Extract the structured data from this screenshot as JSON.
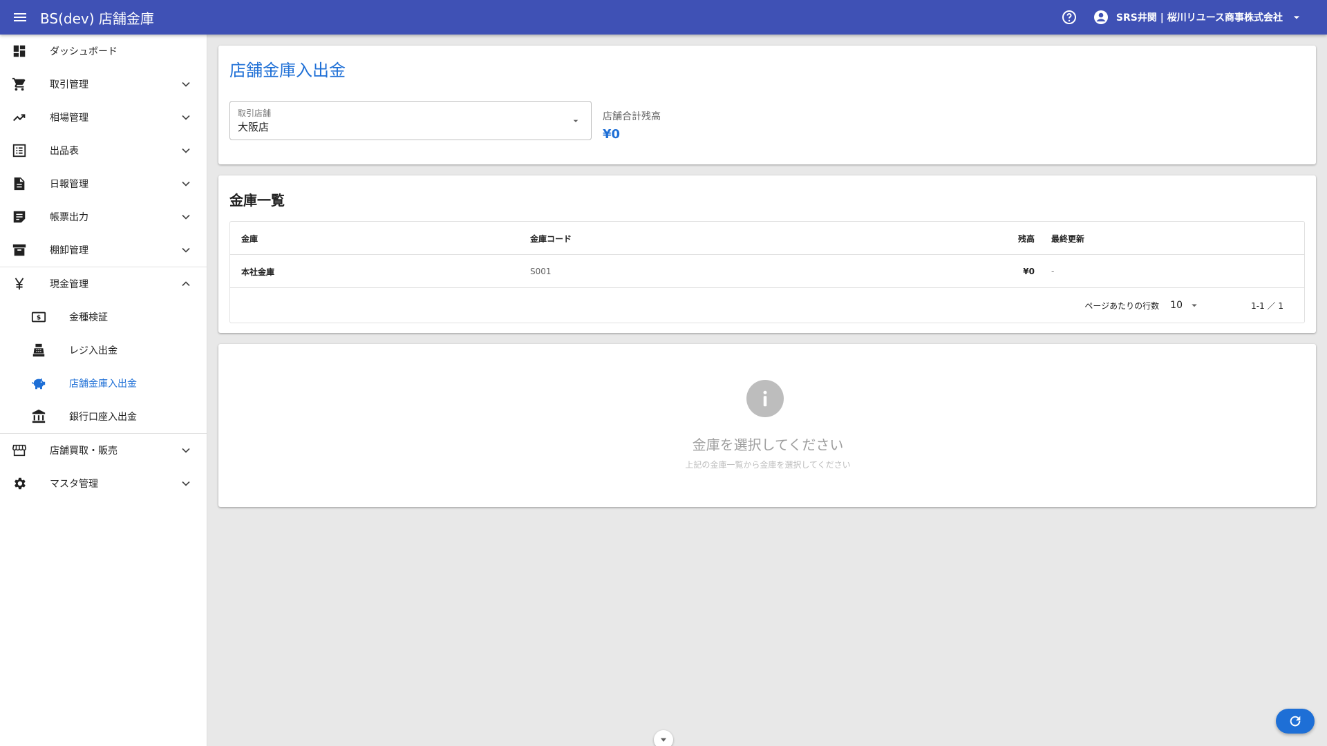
{
  "appbar": {
    "title": "BS(dev) 店舗金庫",
    "account_name": "SRS井関 | 桜川リユース商事株式会社",
    "color": "#3f51b5",
    "icons": [
      "menu-icon",
      "help-icon",
      "account-circle-icon",
      "arrow-drop-down-icon"
    ]
  },
  "sidebar": {
    "items": [
      {
        "label": "ダッシュボード",
        "icon": "dashboard-icon"
      },
      {
        "label": "取引管理",
        "icon": "cart-icon"
      },
      {
        "label": "相場管理",
        "icon": "trending-up-icon"
      },
      {
        "label": "出品表",
        "icon": "list-icon"
      },
      {
        "label": "日報管理",
        "icon": "document-icon"
      },
      {
        "label": "帳票出力",
        "icon": "sticky-note-icon"
      },
      {
        "label": "棚卸管理",
        "icon": "archive-icon"
      },
      {
        "label": "現金管理",
        "icon": "yen-icon"
      },
      {
        "label": "店舗買取・販売",
        "icon": "store-icon"
      },
      {
        "label": "マスタ管理",
        "icon": "gear-icon"
      }
    ],
    "cash_subitems": [
      {
        "label": "金種検証",
        "icon": "money-icon"
      },
      {
        "label": "レジ入出金",
        "icon": "register-icon"
      },
      {
        "label": "店舗金庫入出金",
        "icon": "piggy-bank-icon",
        "active": true
      },
      {
        "label": "銀行口座入出金",
        "icon": "bank-icon"
      }
    ]
  },
  "header_card": {
    "title": "店舗金庫入出金",
    "store_select": {
      "label": "取引店舗",
      "value": "大阪店"
    },
    "total_label": "店舗合計残高",
    "total_value": "¥0"
  },
  "safe_list": {
    "title": "金庫一覧",
    "columns": [
      "金庫",
      "金庫コード",
      "残高",
      "最終更新"
    ],
    "rows": [
      {
        "name": "本社金庫",
        "code": "S001",
        "balance": "¥0",
        "updated": "-"
      }
    ],
    "pagination": {
      "rows_per_page_label": "ページあたりの行数",
      "rows_per_page": "10",
      "range": "1-1 ／ 1"
    }
  },
  "empty_state": {
    "title": "金庫を選択してください",
    "subtitle": "上記の金庫一覧から金庫を選択してください"
  },
  "colors": {
    "accent": "#1e6fd6",
    "appbar": "#3f51b5"
  }
}
